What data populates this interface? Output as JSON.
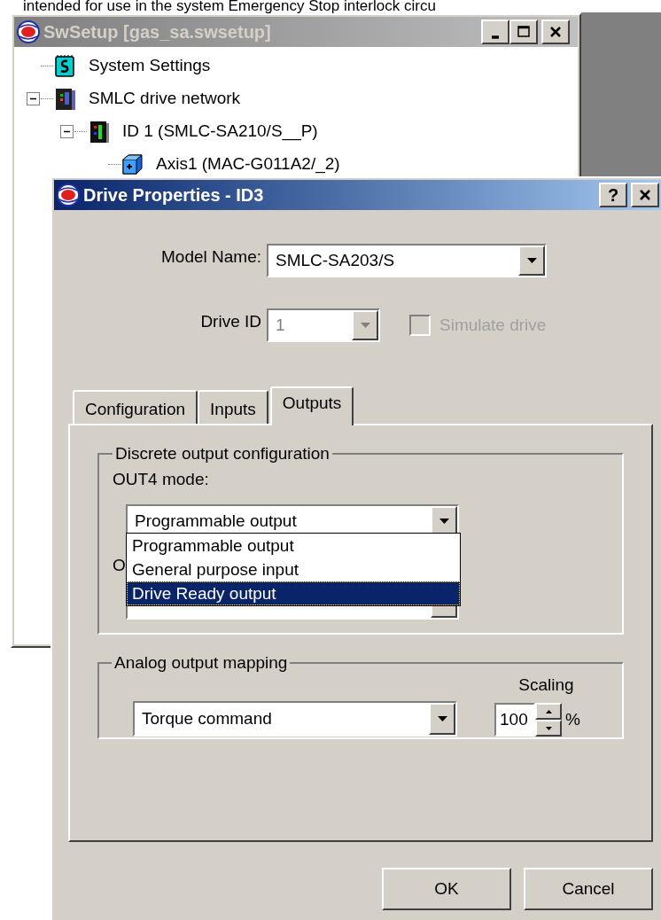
{
  "background_text": "intended for use in the system Emergency Stop interlock circu",
  "main_window": {
    "title": "SwSetup [gas_sa.swsetup]",
    "active": false,
    "tree": [
      {
        "label": "System Settings",
        "kind": "settings"
      },
      {
        "label": "SMLC drive network",
        "kind": "network",
        "expanded": true,
        "children": [
          {
            "label": "ID 1 (SMLC-SA210/S__P)",
            "kind": "drive",
            "expanded": true,
            "children": [
              {
                "label": "Axis1 (MAC-G011A2/_2)",
                "kind": "axis"
              }
            ]
          }
        ]
      }
    ]
  },
  "dialog": {
    "title": "Drive Properties - ID3",
    "active": true,
    "help_button": "?",
    "model_name": {
      "label": "Model Name:",
      "value": "SMLC-SA203/S"
    },
    "drive_id": {
      "label": "Drive ID",
      "value": "1",
      "disabled": true
    },
    "simulate_drive": {
      "label": "Simulate drive",
      "checked": false,
      "disabled": true
    },
    "tabs": [
      {
        "label": "Configuration",
        "selected": false
      },
      {
        "label": "Inputs",
        "selected": false
      },
      {
        "label": "Outputs",
        "selected": true
      }
    ],
    "discrete_output": {
      "title": "Discrete output configuration",
      "out4_label": "OUT4 mode:",
      "out4_value": "Programmable output",
      "second_label": "O",
      "dropdown_options": [
        {
          "label": "Programmable output",
          "selected": false
        },
        {
          "label": "General purpose input",
          "selected": false
        },
        {
          "label": "Drive Ready output",
          "selected": true
        }
      ]
    },
    "analog_output": {
      "title": "Analog output mapping",
      "value": "Torque command",
      "scaling_label": "Scaling",
      "scaling_value": "100",
      "unit": "%"
    },
    "buttons": [
      "OK",
      "Cancel"
    ]
  }
}
